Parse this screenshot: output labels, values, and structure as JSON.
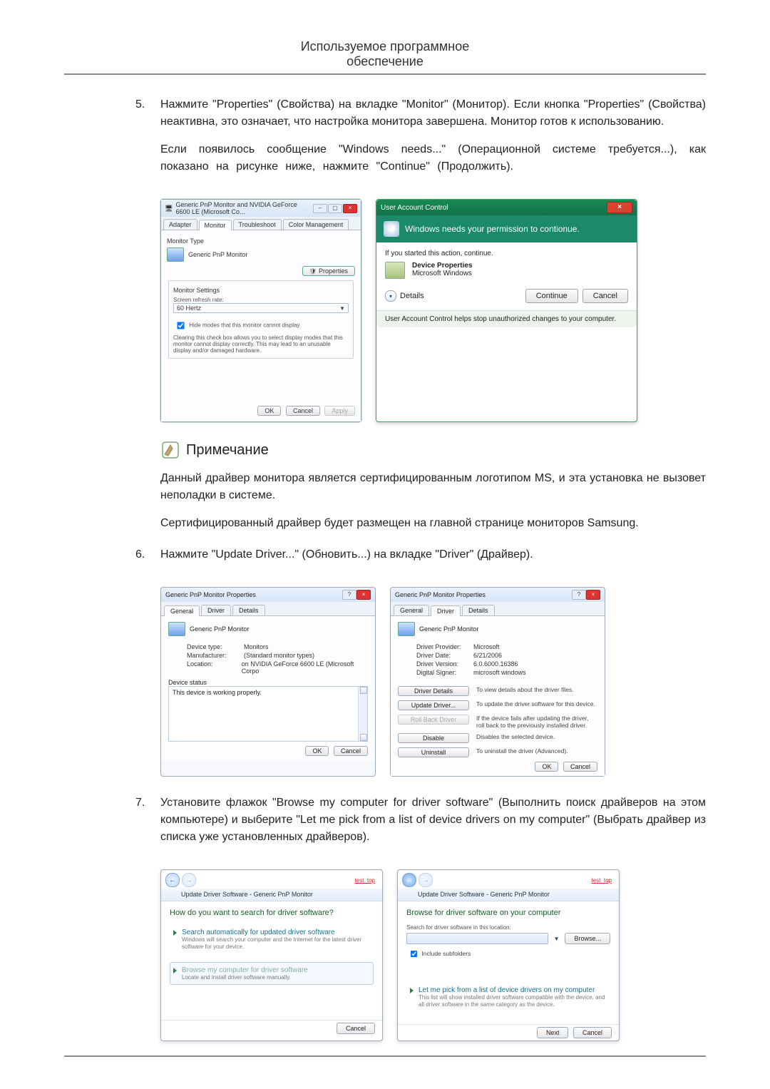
{
  "header": {
    "line1": "Используемое программное",
    "line2": "обеспечение"
  },
  "step5": {
    "num": "5.",
    "p1": "Нажмите \"Properties\" (Свойства) на вкладке \"Monitor\" (Монитор). Если кнопка \"Properties\" (Свойства) неактивна, это означает, что настройка монитора завершена. Монитор готов к использованию.",
    "p2": "Если появилось сообщение \"Windows needs...\" (Операционной системе требуется...), как показано на рисунке ниже, нажмите \"Continue\" (Продолжить)."
  },
  "note": {
    "title": "Примечание",
    "p1": "Данный драйвер монитора является сертифицированным логотипом MS, и эта установка не вызовет неполадки в системе.",
    "p2": "Сертифицированный драйвер будет размещен на главной странице мониторов Samsung."
  },
  "step6": {
    "num": "6.",
    "p1": "Нажмите \"Update Driver...\" (Обновить...) на вкладке \"Driver\" (Драйвер)."
  },
  "step7": {
    "num": "7.",
    "p1": "Установите флажок \"Browse my computer for driver software\" (Выполнить поиск драйверов на этом компьютере) и выберите \"Let me pick from a list of device drivers on my computer\" (Выбрать драйвер из списка уже установленных драйверов)."
  },
  "shot1a": {
    "title": "Generic PnP Monitor and NVIDIA GeForce 6600 LE (Microsoft Co...",
    "tabs": {
      "adapter": "Adapter",
      "monitor": "Monitor",
      "troubleshoot": "Troubleshoot",
      "color": "Color Management"
    },
    "montype": "Monitor Type",
    "monname": "Generic PnP Monitor",
    "properties_btn": "Properties",
    "settings": "Monitor Settings",
    "refresh_lbl": "Screen refresh rate:",
    "refresh_val": "60 Hertz",
    "hide_cb": "Hide modes that this monitor cannot display",
    "hide_desc": "Clearing this check box allows you to select display modes that this monitor cannot display correctly. This may lead to an unusable display and/or damaged hardware.",
    "ok": "OK",
    "cancel": "Cancel",
    "apply": "Apply"
  },
  "shot1b": {
    "title": "User Account Control",
    "banner": "Windows needs your permission to contionue.",
    "ifyou": "If you started this action, continue.",
    "prog": "Device Properties",
    "pub": "Microsoft Windows",
    "details": "Details",
    "continue": "Continue",
    "cancel": "Cancel",
    "footer": "User Account Control helps stop unauthorized changes to your computer."
  },
  "shot2a": {
    "title": "Generic PnP Monitor Properties",
    "tabs": {
      "general": "General",
      "driver": "Driver",
      "details": "Details"
    },
    "name": "Generic PnP Monitor",
    "devtype_k": "Device type:",
    "devtype_v": "Monitors",
    "manuf_k": "Manufacturer:",
    "manuf_v": "(Standard monitor types)",
    "loc_k": "Location:",
    "loc_v": "on NVIDIA GeForce 6600 LE (Microsoft Corpo",
    "status_lbl": "Device status",
    "status_txt": "This device is working properly.",
    "ok": "OK",
    "cancel": "Cancel"
  },
  "shot2b": {
    "title": "Generic PnP Monitor Properties",
    "tabs": {
      "general": "General",
      "driver": "Driver",
      "details": "Details"
    },
    "name": "Generic PnP Monitor",
    "prov_k": "Driver Provider:",
    "prov_v": "Microsoft",
    "date_k": "Driver Date:",
    "date_v": "6/21/2006",
    "ver_k": "Driver Version:",
    "ver_v": "6.0.6000.16386",
    "sign_k": "Digital Signer:",
    "sign_v": "microsoft windows",
    "btn_details": "Driver Details",
    "btn_details_d": "To view details about the driver files.",
    "btn_update": "Update Driver...",
    "btn_update_d": "To update the driver software for this device.",
    "btn_rollback": "Roll Back Driver",
    "btn_rollback_d": "If the device fails after updating the driver, roll back to the previously installed driver.",
    "btn_disable": "Disable",
    "btn_disable_d": "Disables the selected device.",
    "btn_uninstall": "Uninstall",
    "btn_uninstall_d": "To uninstall the driver (Advanced).",
    "ok": "OK",
    "cancel": "Cancel"
  },
  "shot3a": {
    "crumb": "Update Driver Software - Generic PnP Monitor",
    "redlink": "test_top",
    "head": "How do you want to search for driver software?",
    "opt1_t": "Search automatically for updated driver software",
    "opt1_d": "Windows will search your computer and the Internet for the latest driver software for your device.",
    "opt2_t": "Browse my computer for driver software",
    "opt2_d": "Locate and install driver software manually.",
    "cancel": "Cancel"
  },
  "shot3b": {
    "crumb": "Update Driver Software - Generic PnP Monitor",
    "redlink": "test_top",
    "head": "Browse for driver software on your computer",
    "loc_lbl": "Search for driver software in this location:",
    "browse": "Browse...",
    "include": "Include subfolders",
    "opt_t": "Let me pick from a list of device drivers on my computer",
    "opt_d": "This list will show installed driver software compatible with the device, and all driver software in the same category as the device.",
    "next": "Next",
    "cancel": "Cancel"
  }
}
